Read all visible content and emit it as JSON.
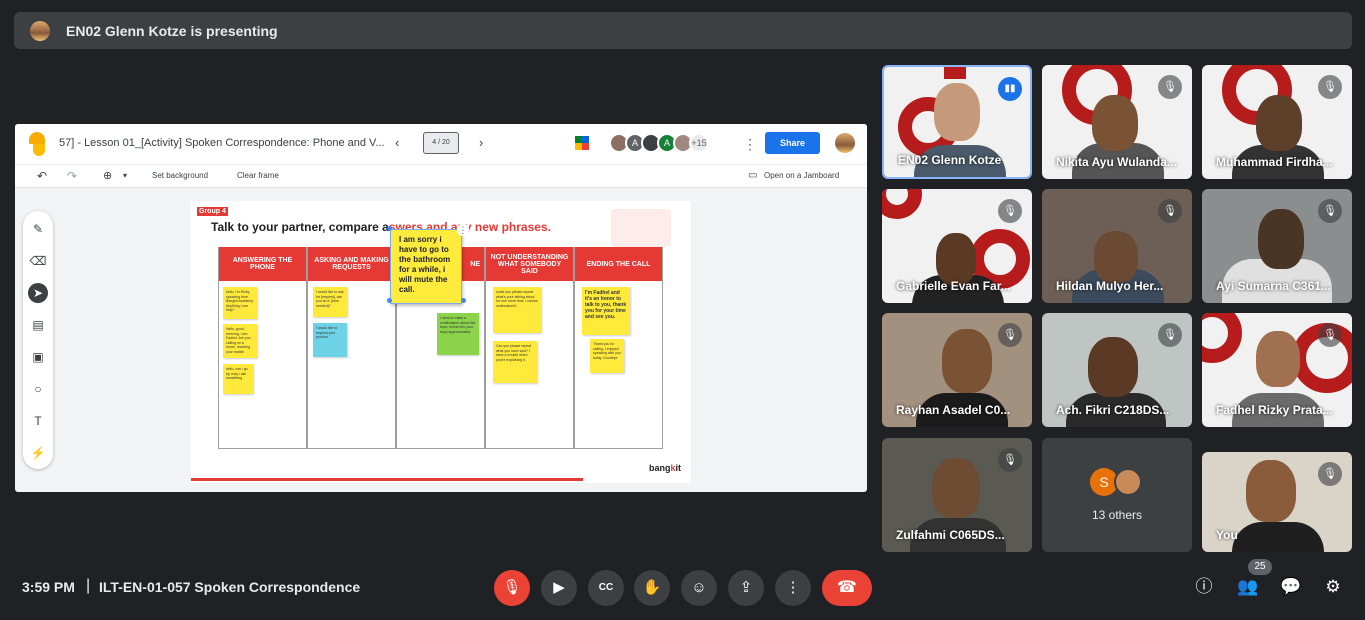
{
  "banner": {
    "text": "EN02 Glenn Kotze is presenting"
  },
  "jamboard": {
    "title": "57] - Lesson 01_[Activity] Spoken Correspondence: Phone and V...",
    "frame_indicator": "4 / 20",
    "participants_extra": "+15",
    "avatar_letters": [
      "A",
      "A"
    ],
    "share_label": "Share",
    "toolbar": {
      "set_background": "Set background",
      "clear_frame": "Clear frame",
      "open_jamboard": "Open on a Jamboard"
    }
  },
  "slide": {
    "group_tag": "Group 4",
    "title_start": "Talk to your partner, compare a",
    "title_mid": "swers",
    "title_red": " and ",
    "title_end": "any new phrases.",
    "columns": [
      "ANSWERING THE PHONE",
      "ASKING AND MAKING REQUESTS",
      "",
      "NOT UNDERSTANDING WHAT SOMEBODY SAID",
      "ENDING THE CALL"
    ],
    "col3_tail": "NE",
    "big_note": "I am sorry i have to go to the bathroom for a while, i will mute the call.",
    "notes": {
      "n1": "hello, i'm Rizky, speaking from Bangkit Academy. Anything i can help?",
      "n2": "Hello, good morning, I am Fadhel. Are you calling on a home, reaching your mobile",
      "n3": "hello, can i go by, may i ask something",
      "n4": "I would like to ask for [request], can you do it. [time needed]?",
      "n5": "I would like to request your product",
      "n6": "I need to make a confirmation about this topic, invest into your reply approximately",
      "n7": "could you please repeat what's your talking about for one more time, i cannot understand it.",
      "n8": "Can you please repeat what you have said? I have a trouble when you're explaining it.",
      "n9": "I'm Fadhel and it's an honor to talk to you, thank you for your time and see you.",
      "n10": "Thank you for calling, i enjoyed speaking with you today. Goodbye"
    },
    "brand_a": "bang",
    "brand_b": "k",
    "brand_c": "it"
  },
  "tiles": [
    {
      "name": "EN02 Glenn Kotze"
    },
    {
      "name": "Nikita Ayu Wulanda..."
    },
    {
      "name": "Muhammad Firdha..."
    },
    {
      "name": "Gabrielle Evan Far..."
    },
    {
      "name": "Hildan Mulyo Her..."
    },
    {
      "name": "Ayi Sumarna C361..."
    },
    {
      "name": "Rayhan Asadel C0..."
    },
    {
      "name": "Ach. Fikri C218DS..."
    },
    {
      "name": "Fadhel Rizky Prata..."
    },
    {
      "name": "Zulfahmi C065DS..."
    },
    {
      "name": "13 others",
      "letter": "S"
    },
    {
      "name": "You"
    }
  ],
  "bottom": {
    "time": "3:59 PM",
    "separator": "|",
    "meeting": "ILT-EN-01-057 Spoken Correspondence",
    "participant_count": "25"
  },
  "icons": {
    "mic_off": "mic-off-icon",
    "camera": "camera-icon",
    "captions": "cc-icon",
    "hand": "raise-hand-icon",
    "emoji": "emoji-icon",
    "present": "present-icon",
    "more": "more-icon",
    "end": "end-call-icon",
    "info": "info-icon",
    "people": "people-icon",
    "chat": "chat-icon",
    "activities": "activities-icon"
  },
  "colors": {
    "end_call": "#ea4335",
    "accent": "#1a73e8",
    "slide_red": "#e53935",
    "sticky_yellow": "#ffea3b"
  }
}
